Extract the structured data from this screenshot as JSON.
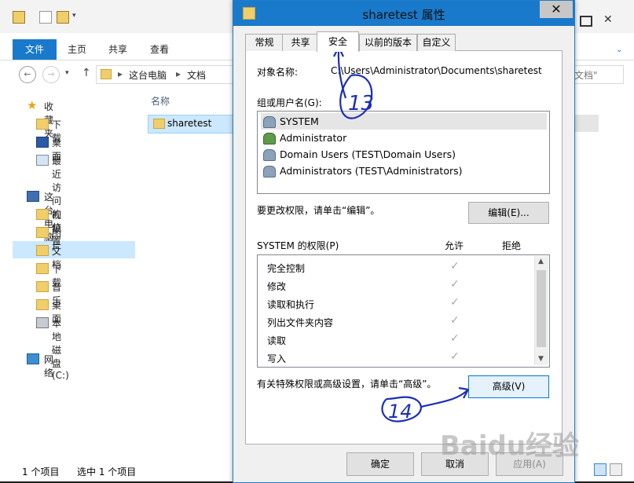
{
  "explorer": {
    "ribbon_tabs": [
      "文件",
      "主页",
      "共享",
      "查看"
    ],
    "breadcrumb": [
      "这台电脑",
      "文档"
    ],
    "search_placeholder": "文档\"",
    "nav": {
      "favorites": "收藏夹",
      "favorites_items": [
        "下载",
        "桌面",
        "最近访问的位置"
      ],
      "this_pc": "这台电脑",
      "this_pc_items": [
        "视频",
        "图片",
        "文档",
        "下载",
        "音乐",
        "桌面",
        "本地磁盘 (C:)"
      ],
      "network": "网络"
    },
    "column_name": "名称",
    "file_name": "sharetest",
    "status": {
      "count": "1 个项目",
      "selected": "选中 1 个项目"
    }
  },
  "dialog": {
    "title": "sharetest 属性",
    "close_glyph": "✕",
    "tabs": [
      "常规",
      "共享",
      "安全",
      "以前的版本",
      "自定义"
    ],
    "object_label": "对象名称:",
    "object_value": "C:\\Users\\Administrator\\Documents\\sharetest",
    "group_label": "组或用户名(G):",
    "users": [
      "SYSTEM",
      "Administrator",
      "Domain Users (TEST\\Domain Users)",
      "Administrators (TEST\\Administrators)"
    ],
    "edit_hint": "要更改权限，请单击“编辑”。",
    "edit_button": "编辑(E)...",
    "perm_header": "SYSTEM 的权限(P)",
    "allow_header": "允许",
    "deny_header": "拒绝",
    "permissions": [
      "完全控制",
      "修改",
      "读取和执行",
      "列出文件夹内容",
      "读取",
      "写入"
    ],
    "check_glyph": "✓",
    "advanced_hint": "有关特殊权限或高级设置，请单击“高级”。",
    "advanced_button": "高级(V)",
    "ok_button": "确定",
    "cancel_button": "取消",
    "apply_button": "应用(A)"
  },
  "annotations": {
    "step13": "13",
    "step14": "14"
  },
  "watermark": "Baidu经验",
  "colors": {
    "accent": "#1979ca",
    "selection": "#cce8ff",
    "ink": "#1b2fb3"
  }
}
